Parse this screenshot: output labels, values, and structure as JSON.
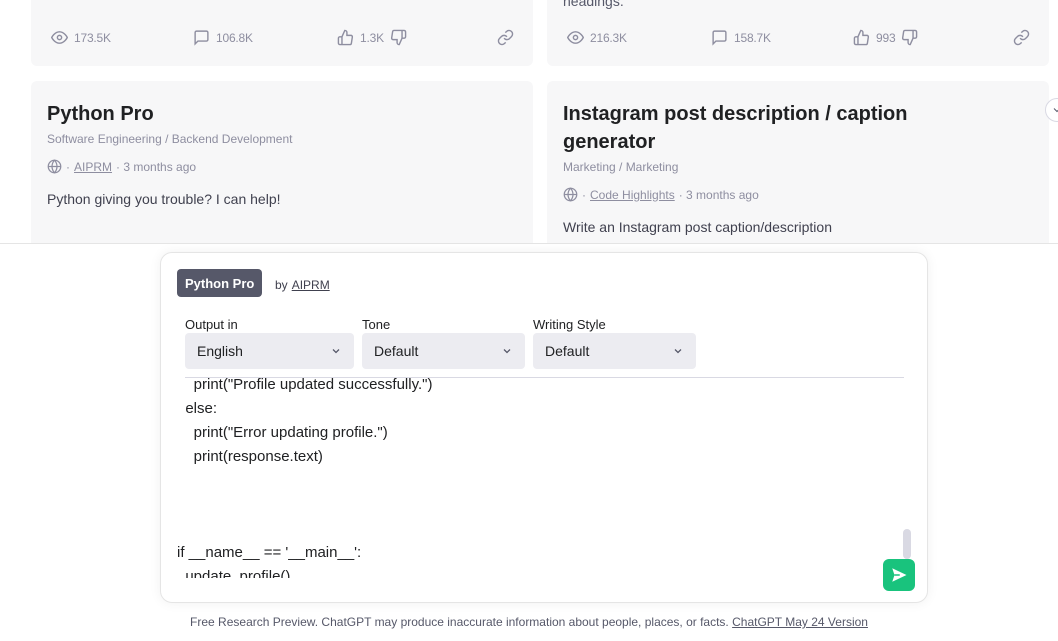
{
  "cards": {
    "top_left": {
      "views": "173.5K",
      "comments": "106.8K",
      "likes": "1.3K"
    },
    "top_right": {
      "partial_text": "headings.",
      "views": "216.3K",
      "comments": "158.7K",
      "likes": "993"
    },
    "bottom_left": {
      "title": "Python Pro",
      "category": "Software Engineering / Backend Development",
      "author": "AIPRM",
      "time": "· 3 months ago",
      "description": "Python giving you trouble? I can help!"
    },
    "bottom_right": {
      "title": "Instagram post description / caption generator",
      "category": "Marketing / Marketing",
      "author": "Code Highlights",
      "time": "· 3 months ago",
      "description": "Write an Instagram post caption/description"
    }
  },
  "composer": {
    "prompt_badge": "Python Pro",
    "by_label": "by",
    "by_author": "AIPRM",
    "output_label": "Output in",
    "output_value": "English",
    "tone_label": "Tone",
    "tone_value": "Default",
    "style_label": "Writing Style",
    "style_value": "Default",
    "code_lines": [
      "    print(\"Profile updated successfully.\")",
      "  else:",
      "    print(\"Error updating profile.\")",
      "    print(response.text)",
      "if __name__ == '__main__':",
      "  update_profile()"
    ]
  },
  "footer": {
    "text": "Free Research Preview. ChatGPT may produce inaccurate information about people, places, or facts. ",
    "link": "ChatGPT May 24 Version"
  },
  "colors": {
    "accent": "#19c37d",
    "badge_bg": "#565869",
    "card_bg": "#f7f7f8"
  },
  "icons": [
    "eye-icon",
    "comment-icon",
    "thumbs-up-icon",
    "thumbs-down-icon",
    "link-icon",
    "globe-icon",
    "chevron-down-icon",
    "send-icon"
  ]
}
